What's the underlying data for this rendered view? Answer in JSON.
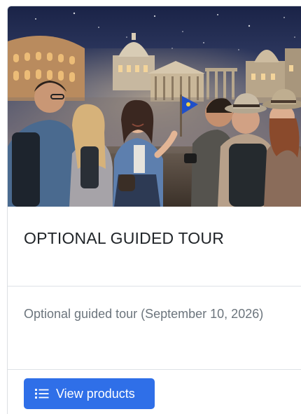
{
  "card": {
    "image": {
      "description_icon": "tour-group-photo",
      "flag_color": "#1f4fc9"
    },
    "title": "OPTIONAL GUIDED TOUR",
    "description": "Optional guided tour (September 10, 2026)",
    "button": {
      "label": "View products",
      "icon": "list-icon",
      "color": "#2f6fe8"
    }
  }
}
